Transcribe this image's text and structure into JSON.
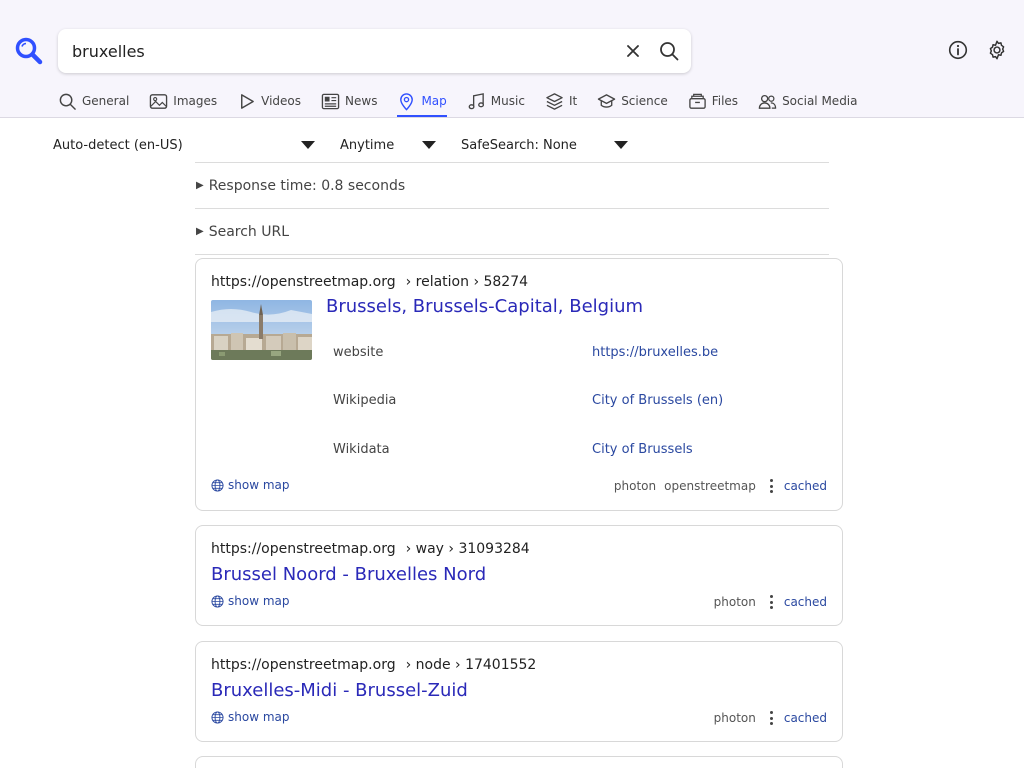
{
  "search": {
    "value": "bruxelles",
    "placeholder": ""
  },
  "tabs": [
    {
      "label": "General",
      "icon": "search-icon"
    },
    {
      "label": "Images",
      "icon": "image-icon"
    },
    {
      "label": "Videos",
      "icon": "play-icon"
    },
    {
      "label": "News",
      "icon": "newspaper-icon"
    },
    {
      "label": "Map",
      "icon": "map-pin-icon",
      "active": true
    },
    {
      "label": "Music",
      "icon": "music-note-icon"
    },
    {
      "label": "It",
      "icon": "layers-icon"
    },
    {
      "label": "Science",
      "icon": "graduation-cap-icon"
    },
    {
      "label": "Files",
      "icon": "archive-icon"
    },
    {
      "label": "Social Media",
      "icon": "people-icon"
    }
  ],
  "filters": {
    "language": "Auto-detect (en-US)",
    "time": "Anytime",
    "safesearch": "SafeSearch: None"
  },
  "details": {
    "response_time": "Response time: 0.8 seconds",
    "search_url": "Search URL"
  },
  "results": [
    {
      "url": "https://openstreetmap.org",
      "path": "› relation › 58274",
      "title": "Brussels, Brussels-Capital, Belgium",
      "attributes": [
        {
          "label": "website",
          "value": "https://bruxelles.be"
        },
        {
          "label": "Wikipedia",
          "value": "City of Brussels (en)"
        },
        {
          "label": "Wikidata",
          "value": "City of Brussels"
        }
      ],
      "show_map": "show map",
      "engines": [
        "photon",
        "openstreetmap"
      ],
      "cached": "cached"
    },
    {
      "url": "https://openstreetmap.org",
      "path": "› way › 31093284",
      "title": "Brussel Noord - Bruxelles Nord",
      "show_map": "show map",
      "engines": [
        "photon"
      ],
      "cached": "cached"
    },
    {
      "url": "https://openstreetmap.org",
      "path": "› node › 17401552",
      "title": "Bruxelles-Midi - Brussel-Zuid",
      "show_map": "show map",
      "engines": [
        "photon"
      ],
      "cached": "cached"
    }
  ],
  "colors": {
    "accent": "#3050ff",
    "link": "#2a29b8",
    "header_bg": "#f7f5fc"
  }
}
